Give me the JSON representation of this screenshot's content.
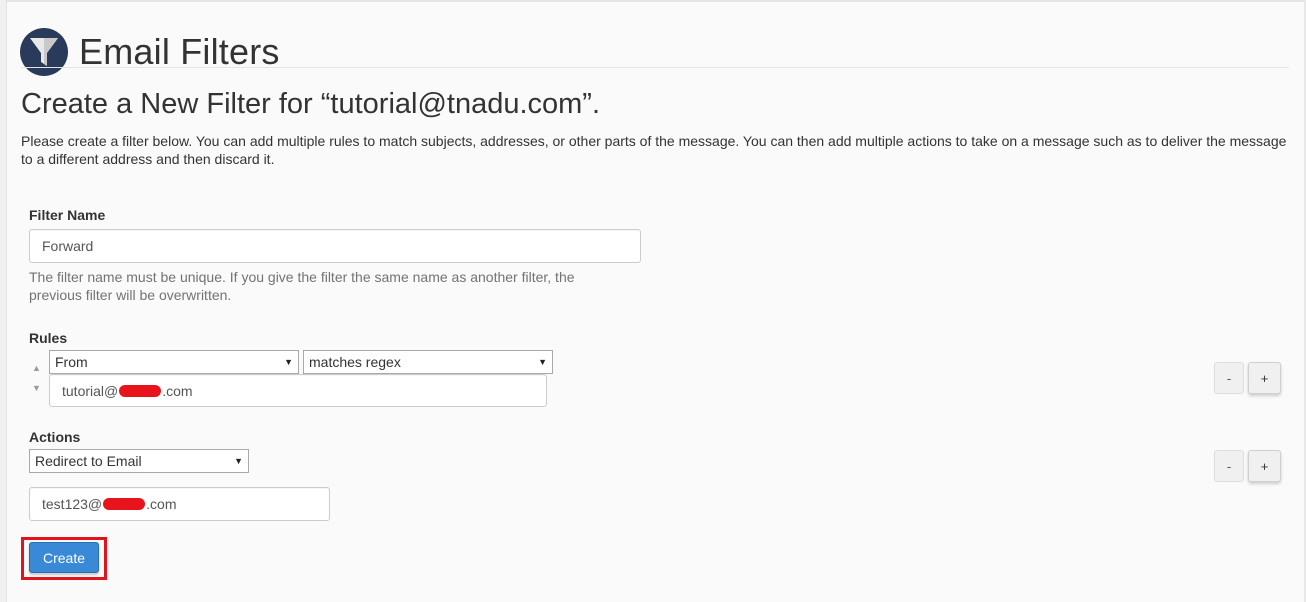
{
  "header": {
    "title": "Email Filters",
    "icon": "funnel-icon"
  },
  "subtitle": "Create a New Filter for “tutorial@tnadu.com”.",
  "description": "Please create a filter below. You can add multiple rules to match subjects, addresses, or other parts of the message. You can then add multiple actions to take on a message such as to deliver the message to a different address and then discard it.",
  "filter_name": {
    "label": "Filter Name",
    "value": "Forward",
    "help": "The filter name must be unique. If you give the filter the same name as another filter, the previous filter will be overwritten."
  },
  "rules": {
    "label": "Rules",
    "part_select": "From",
    "match_select": "matches regex",
    "value_prefix": "tutorial@",
    "value_suffix": ".com",
    "move_up_icon": "triangle-up-icon",
    "move_down_icon": "triangle-down-icon",
    "remove_label": "-",
    "add_label": "+"
  },
  "actions": {
    "label": "Actions",
    "action_select": "Redirect to Email",
    "value_prefix": "test123@",
    "value_suffix": ".com",
    "remove_label": "-",
    "add_label": "+"
  },
  "submit": {
    "label": "Create",
    "highlight_color": "#e0141c",
    "button_color": "#3a89d6"
  }
}
